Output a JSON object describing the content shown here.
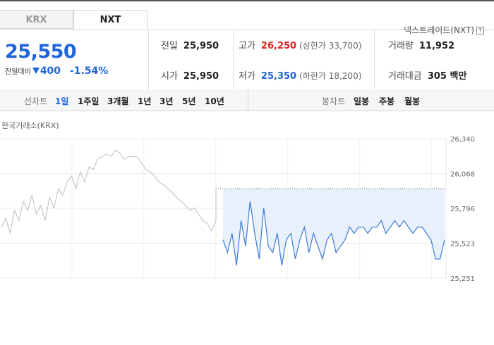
{
  "tabs": [
    "KRX",
    "NXT"
  ],
  "nxt_link": "넥스트레이드(NXT)",
  "help_glyph": "?",
  "price": "25,550",
  "change_label": "전일대비",
  "change_value": "400",
  "change_pct": "-1.54%",
  "colors": {
    "up": "#e02020",
    "down": "#1f64d8",
    "nxt_line": "#3b7bd4",
    "krx_line": "#bdbdbd",
    "fill": "#e8f0fb"
  },
  "stats": {
    "prev_close_label": "전일",
    "prev_close": "25,950",
    "open_label": "시가",
    "open": "25,950",
    "high_label": "고가",
    "high": "26,250",
    "upper_limit": "(상한가 33,700)",
    "low_label": "저가",
    "low": "25,350",
    "lower_limit": "(하한가 18,200)",
    "volume_label": "거래량",
    "volume": "11,952",
    "amount_label": "거래대금",
    "amount": "305 백만"
  },
  "toolbar": {
    "line_label": "선차트",
    "periods": [
      "1일",
      "1주일",
      "3개월",
      "1년",
      "3년",
      "5년",
      "10년"
    ],
    "active_period": "1일",
    "candle_label": "봉차트",
    "candles": [
      "일봉",
      "주봉",
      "월봉"
    ]
  },
  "chart_data": {
    "type": "line",
    "exchange_label": "한국거래소(KRX)",
    "y_ticks": [
      "26,340",
      "26,068",
      "25,796",
      "25,523",
      "25,251"
    ],
    "ylim": [
      25251,
      26340
    ],
    "reference_price": 25950,
    "grid": true,
    "series": [
      {
        "values": [
          25650,
          25720,
          25600,
          25780,
          25700,
          25850,
          25780,
          25900,
          25750,
          25820,
          25700,
          25880,
          25800,
          25950,
          25900,
          26000,
          26050,
          25950,
          26080,
          26000,
          26120,
          26100,
          26180,
          26200,
          26220,
          26200,
          26250,
          26230,
          26180,
          26200,
          26200,
          26200,
          26150,
          26100,
          26080,
          26050,
          26000,
          25980,
          25950,
          25920,
          25880,
          25850,
          25820,
          25780,
          25800,
          25750,
          25700,
          25680,
          25620,
          25700
        ]
      },
      {
        "values": [
          25550,
          25450,
          25600,
          25350,
          25700,
          25500,
          25850,
          25600,
          25400,
          25800,
          25500,
          25450,
          25600,
          25350,
          25550,
          25600,
          25400,
          25550,
          25650,
          25450,
          25600,
          25500,
          25400,
          25550,
          25600,
          25450,
          25500,
          25550,
          25650,
          25600,
          25650,
          25650,
          25600,
          25650,
          25650,
          25700,
          25600,
          25650,
          25700,
          25650,
          25700,
          25650,
          25600,
          25650,
          25650,
          25600,
          25550,
          25400,
          25400,
          25550
        ]
      }
    ]
  }
}
